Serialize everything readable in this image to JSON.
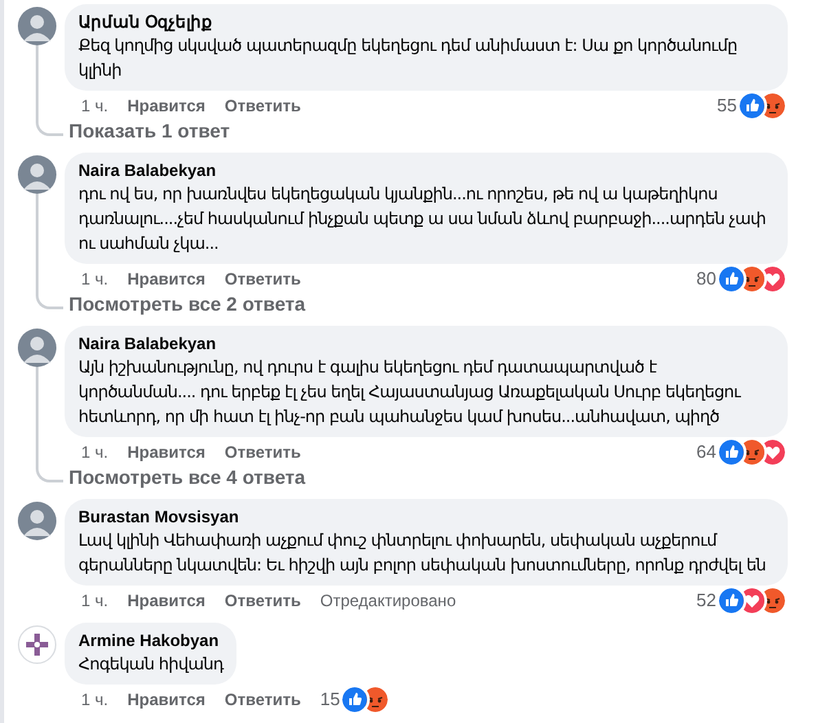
{
  "comments": [
    {
      "author": "Արման Օզչելիք",
      "avatar": {
        "kind": "photo"
      },
      "text": "Քեզ կողմից սկսված պատերազմը եկեղեցու դեմ անիմաստ է: Սա քո կործանումը կլինի",
      "actions": [
        "1 ч.",
        "Нравится",
        "Ответить"
      ],
      "reaction_count": "55",
      "reactions": [
        {
          "kind": "like"
        },
        {
          "kind": "angry"
        }
      ],
      "replies_link": "Показать 1 ответ"
    },
    {
      "author": "Naira Balabekyan",
      "avatar": {
        "kind": "photo"
      },
      "text": "դու ով ես, որ խառնվես եկեղեցական կյանքին...ու որոշես, թե ով ա կաթեղիկոս դառնալու....չեմ հասկանում ինչքան պետք ա սա նման ձևով բարբաջի....արդեն չափ ու սահման չկա...",
      "actions": [
        "1 ч.",
        "Нравится",
        "Ответить"
      ],
      "reaction_count": "80",
      "reactions": [
        {
          "kind": "like"
        },
        {
          "kind": "angry"
        },
        {
          "kind": "love"
        }
      ],
      "replies_link": "Посмотреть все 2 ответа"
    },
    {
      "author": "Naira Balabekyan",
      "avatar": {
        "kind": "photo"
      },
      "text": "Այն իշխանությունը, ով դուրս է գալիս եկեղեցու դեմ դատապարտված է կործանման.... դու երբեք էլ չես եղել Հայաստանյաց Առաքելական Սուրբ եկեղեցու հետևորդ, որ մի հատ էլ ինչ-որ բան պահանջես կամ խոսես...անհավատ, պիղծ",
      "actions": [
        "1 ч.",
        "Нравится",
        "Ответить"
      ],
      "reaction_count": "64",
      "reactions": [
        {
          "kind": "like"
        },
        {
          "kind": "angry"
        },
        {
          "kind": "love"
        }
      ],
      "replies_link": "Посмотреть все 4 ответа"
    },
    {
      "author": "Burastan Movsisyan",
      "avatar": {
        "kind": "photo"
      },
      "text": "Լավ կլինի Վեհափառի աչքում փուշ փնտրելու փոխարեն, սեփական աչքերում գերանները նկատվեն: Եւ հիշվի այն բոլոր սեփական խոստումները, որոնք դրժվել են",
      "actions": [
        "1 ч.",
        "Нравится",
        "Ответить",
        "Отредактировано"
      ],
      "reaction_count": "52",
      "reactions": [
        {
          "kind": "like"
        },
        {
          "kind": "love"
        },
        {
          "kind": "angry"
        }
      ]
    },
    {
      "author": "Armine Hakobyan",
      "avatar": {
        "kind": "emblem"
      },
      "text": "Հոգեկան հիվանդ",
      "actions": [
        "1 ч.",
        "Нравится",
        "Ответить"
      ],
      "reaction_count": "15",
      "reactions": [
        {
          "kind": "like"
        },
        {
          "kind": "angry"
        }
      ]
    }
  ]
}
